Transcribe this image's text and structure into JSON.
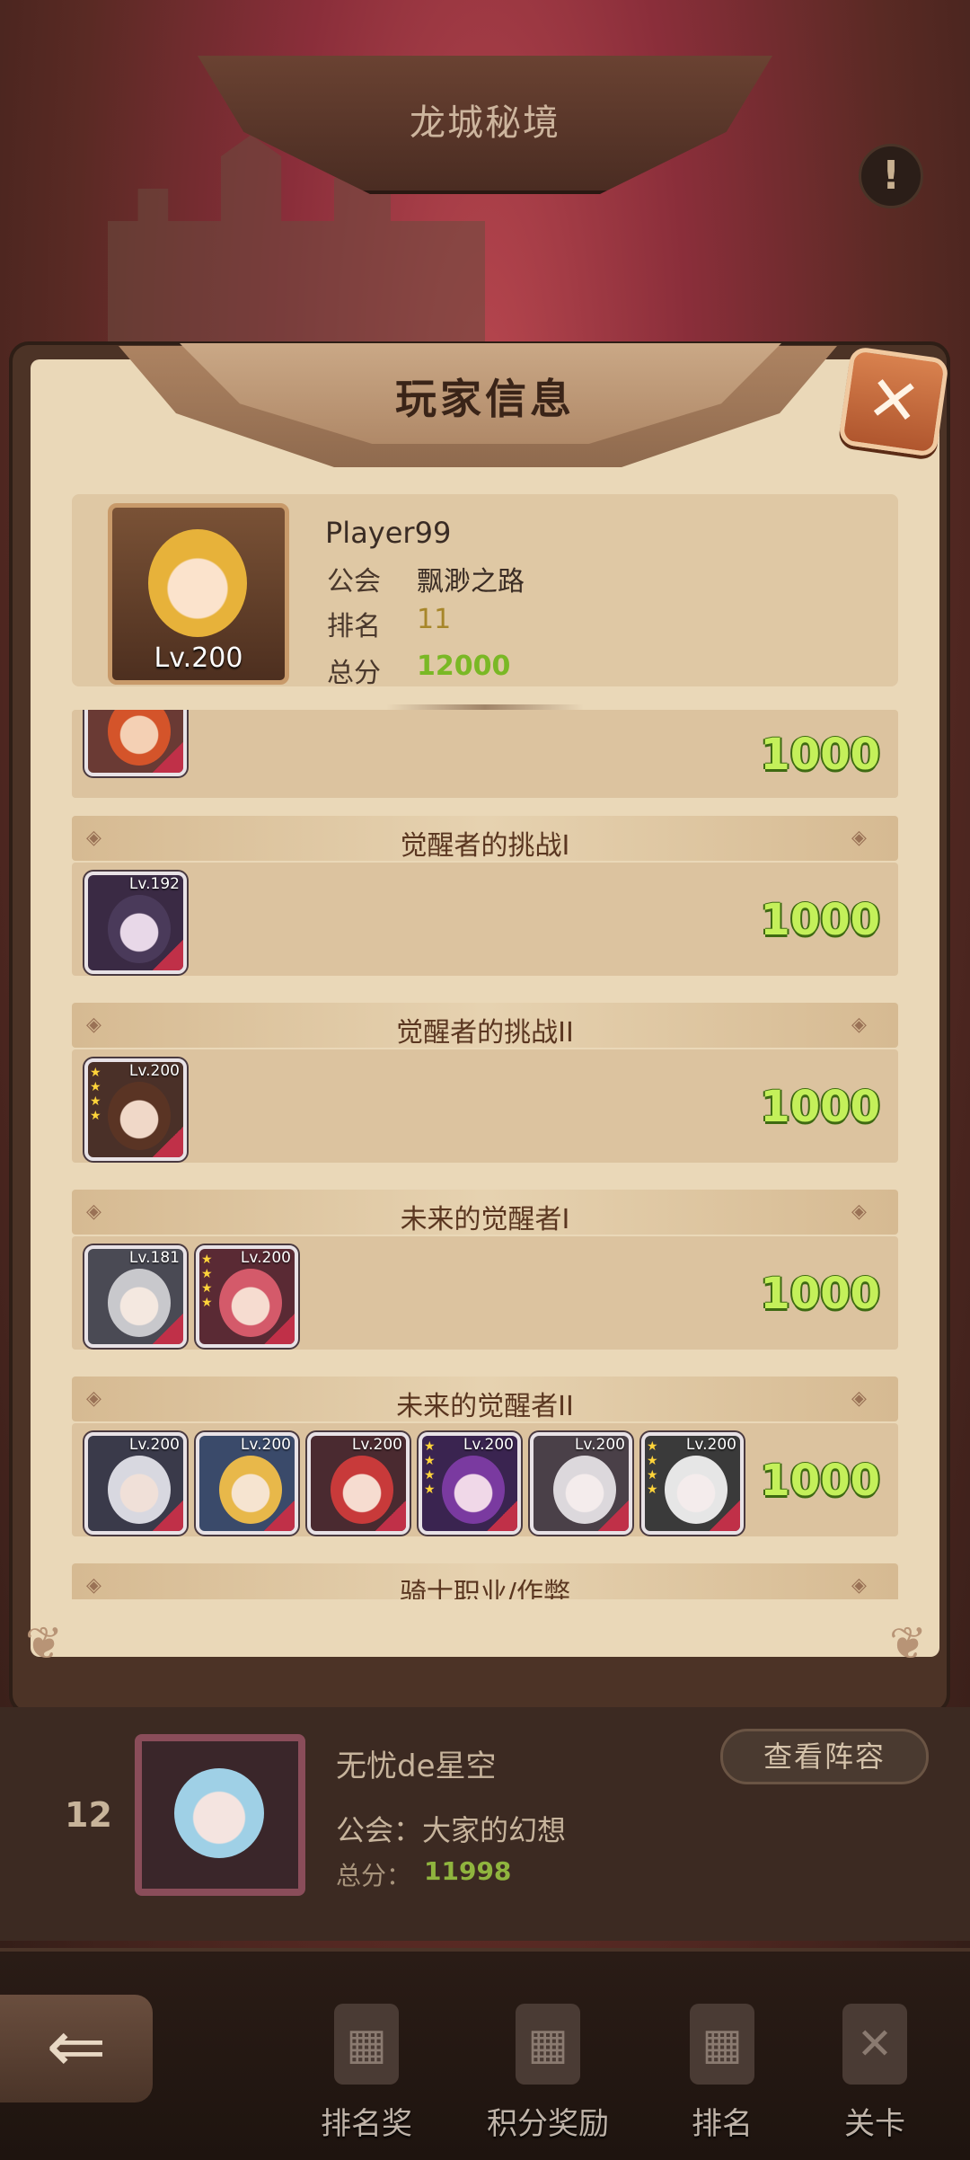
{
  "top": {
    "title": "龙城秘境",
    "alert_icon": "!"
  },
  "modal": {
    "title": "玩家信息",
    "close_label": "✕",
    "player": {
      "name": "Player99",
      "level": "Lv.200",
      "guild_label": "公会",
      "guild_value": "飘渺之路",
      "rank_label": "排名",
      "rank_value": "11",
      "score_label": "总分",
      "score_value": "12000"
    },
    "top_row": {
      "score": "1000"
    },
    "sections": [
      {
        "title": "觉醒者的挑战I",
        "score": "1000",
        "heroes": [
          {
            "level": "Lv.192"
          }
        ]
      },
      {
        "title": "觉醒者的挑战II",
        "score": "1000",
        "heroes": [
          {
            "level": "Lv.200"
          }
        ]
      },
      {
        "title": "未来的觉醒者I",
        "score": "1000",
        "heroes": [
          {
            "level": "Lv.181"
          },
          {
            "level": "Lv.200"
          }
        ]
      },
      {
        "title": "未来的觉醒者II",
        "score": "1000",
        "heroes": [
          {
            "level": "Lv.200"
          },
          {
            "level": "Lv.200"
          },
          {
            "level": "Lv.200"
          },
          {
            "level": "Lv.200"
          },
          {
            "level": "Lv.200"
          },
          {
            "level": "Lv.200"
          }
        ]
      },
      {
        "title": "骑士职业/作弊"
      }
    ]
  },
  "rank_entry": {
    "rank": "12",
    "name": "无忧de星空",
    "guild": "公会：大家的幻想",
    "score_label": "总分：",
    "score_value": "11998",
    "view_button": "查看阵容"
  },
  "nav": {
    "back_icon": "⇐",
    "items": [
      {
        "label": "排名奖",
        "icon": "trophy-icon"
      },
      {
        "label": "积分奖励",
        "icon": "scroll-icon"
      },
      {
        "label": "排名",
        "icon": "rank-icon"
      },
      {
        "label": "关卡",
        "icon": "stage-icon"
      }
    ]
  }
}
